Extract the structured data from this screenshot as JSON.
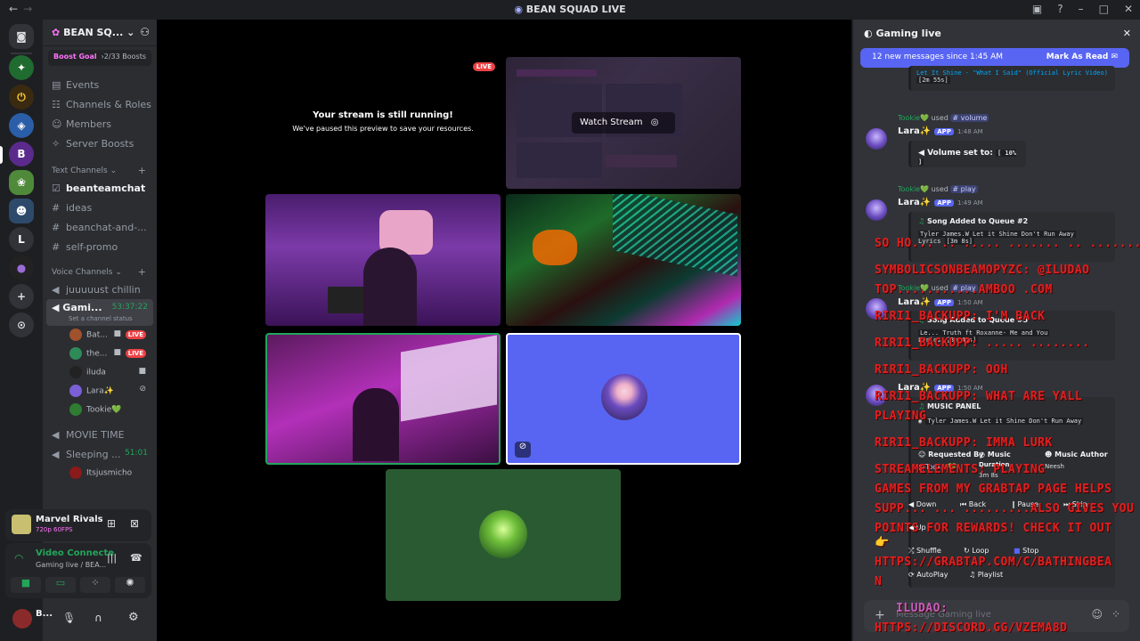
{
  "window": {
    "title": "BEAN SQUAD LIVE"
  },
  "server": {
    "name": "BEAN SQ...",
    "boost_goal_label": "Boost Goal",
    "boost_count": "2/33 Boosts",
    "menu": [
      "Events",
      "Channels & Roles",
      "Members",
      "Server Boosts"
    ],
    "text_category": "Text Channels",
    "text_channels": [
      "beanteamchat",
      "ideas",
      "beanchat-and-...",
      "self-promo"
    ],
    "voice_category": "Voice Channels",
    "voice_channels": {
      "first": "juuuuust chillin",
      "active": "Gami...",
      "active_time": "53:37:22",
      "status_hint": "Set a channel status",
      "users": [
        {
          "name": "Bat...",
          "live": "LIVE"
        },
        {
          "name": "the...",
          "live": "LIVE"
        },
        {
          "name": "iluda"
        },
        {
          "name": "Lara✨"
        },
        {
          "name": "Tookie💚"
        }
      ],
      "movie": "MOVIE TIME",
      "sleeping": "Sleeping ...",
      "sleeping_time": "51:01",
      "sleep_user": "Itsjusmicho"
    }
  },
  "activity": {
    "game": "Marvel Rivals",
    "quality": "720p 60FPS"
  },
  "voice_status": {
    "title": "Video Connecte",
    "subtitle": "Gaming live / BEA..."
  },
  "user": {
    "name": "B..."
  },
  "stream": {
    "live": "LIVE",
    "notice_title": "Your stream is still running!",
    "notice_body": "We've paused this preview to save your resources.",
    "watch": "Watch Stream"
  },
  "chat": {
    "channel": "Gaming live",
    "new_messages": "12 new messages since 1:45 AM",
    "mark_read": "Mark As Read",
    "top_song": "Let It Shine - \"What I Said\" (Official Lyric Video)",
    "top_dur": "[2m 55s]",
    "messages": [
      {
        "used_by": "Tookie💚",
        "used_word": "used",
        "cmd": "volume",
        "user": "Lara✨",
        "app": "APP",
        "time": "1:48 AM",
        "body_label": "Volume set to:",
        "body_value": "[ 10% ]"
      },
      {
        "used_by": "Tookie💚",
        "used_word": "used",
        "cmd": "play",
        "user": "Lara✨",
        "app": "APP",
        "time": "1:49 AM",
        "title": "Song Added to Queue #2",
        "song": "Tyler James.W Let it Shine Don't Run Away",
        "lyrics": "Lyrics",
        "dur": "[3m 8s]"
      },
      {
        "used_by": "Tookie💚",
        "used_word": "used",
        "cmd": "play",
        "user": "Lara✨",
        "app": "APP",
        "time": "1:50 AM",
        "title": "Song Added to Queue #3",
        "song": "Le... Truth ft Roxanne- Me and You",
        "lyrics": "Lyrics",
        "dur": "[3m 40s]"
      },
      {
        "user": "Lara✨",
        "app": "APP",
        "time": "1:50 AM",
        "title": "MUSIC PANEL",
        "song": "Tyler James.W Let it Shine Don't Run Away",
        "requested_by": "Requested By",
        "music": "Music",
        "duration": "Duration",
        "duration_val": "3m 8s",
        "music_author": "Music Author",
        "author_val": "Neesh",
        "req_user": "@Tookie💚",
        "buttons": [
          "Down",
          "Back",
          "Pause",
          "Skip",
          "Up",
          "Shuffle",
          "Loop",
          "Stop",
          "AutoPlay",
          "Playlist"
        ]
      }
    ],
    "input_placeholder": "Message Gaming live"
  },
  "overlay": {
    "lines": [
      "SO HO... .. ..... ....... .. .......",
      "SYMBOLICSONBEAMOPYZC: @ILUDAO",
      "TOP...........AMBOO .COM",
      "RIRI1_BACKUPP: I'M BACK",
      "RIRI1_BACKUPP: ..... ........",
      "RIRI1_BACKUPP: OOH",
      "RIRI1_BACKUPP: WHAT ARE YALL",
      "PLAYING",
      "RIRI1_BACKUPP: IMMA LURK",
      "STREAMELEMENTS: PLAYING",
      "GAMES FROM MY GRABTAP PAGE HELPS",
      "SUPP... ... .........ALSO GIVES YOU",
      "POINTS FOR REWARDS! CHECK IT OUT",
      "👉",
      "HTTPS://GRABTAP.COM/C/BATHINGBEA",
      "N",
      "ILUDAO:",
      "HTTPS://DISCORD.GG/VZEMA8D"
    ]
  },
  "colors": {
    "accent": "#5865f2",
    "live": "#ed4245",
    "green": "#23a55a",
    "overlay_red": "#e02020"
  }
}
